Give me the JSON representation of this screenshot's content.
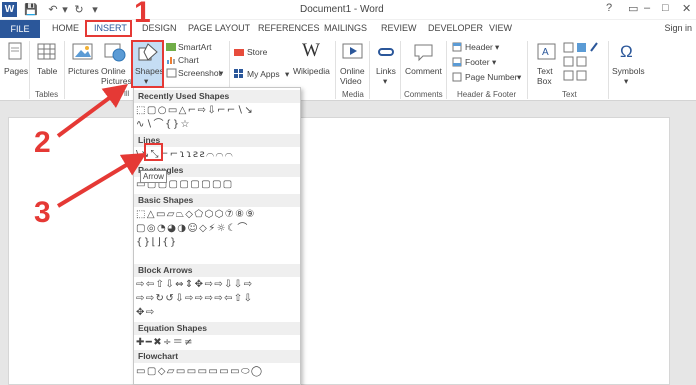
{
  "window": {
    "title": "Document1 - Word",
    "help": "?",
    "minimize": "–",
    "restore": "□",
    "close": "✕"
  },
  "tabs": {
    "file": "FILE",
    "items": [
      "HOME",
      "INSERT",
      "DESIGN",
      "PAGE LAYOUT",
      "REFERENCES",
      "MAILINGS",
      "REVIEW",
      "DEVELOPER",
      "VIEW"
    ],
    "sign_in": "Sign in"
  },
  "ribbon": {
    "pages": "Pages",
    "table": "Table",
    "pictures": "Pictures",
    "online_pictures": "Online Pictures",
    "shapes": "Shapes",
    "smartart": "SmartArt",
    "chart": "Chart",
    "screenshot": "Screenshot",
    "store": "Store",
    "my_apps": "My Apps",
    "wikipedia": "Wikipedia",
    "online_video": "Online Video",
    "links": "Links",
    "comment": "Comment",
    "header": "Header",
    "footer": "Footer",
    "page_number": "Page Number",
    "text_box": "Text Box",
    "symbols": "Symbols",
    "groups": {
      "tables": "Tables",
      "media": "Media",
      "comments": "Comments",
      "header_footer": "Header & Footer",
      "text": "Text"
    },
    "word_logo_glyph": "W",
    "wikipedia_glyph": "W",
    "omega_glyph": "Ω"
  },
  "shapes_gallery": {
    "categories": [
      {
        "name": "Recently Used Shapes",
        "rows": [
          "⬚▢○▭△⌐⇨⇩⌐⌐∖↘",
          "∿∖⌒{}☆"
        ]
      },
      {
        "name": "Lines",
        "rows": [
          "\\↘⤡⌐⌐ɿɿƨƨ⌒⌒⌒"
        ]
      },
      {
        "name": "Rectangles",
        "rows": [
          "▭▢▢▢▢▢▢▢▢"
        ]
      },
      {
        "name": "Basic Shapes",
        "rows": [
          "⬚△▭▱⏢◇⬠⬡⬡⑦⑧⑨",
          "▢◎◔◕◑☺◇⚡☼☾⌒",
          "{}⌊⌋{}"
        ]
      },
      {
        "name": "Block Arrows",
        "rows": [
          "⇨⇦⇧⇩⇔⇕✥⇨⇨⇩⇩⇨",
          "⇨⇨↻↺⇩⇨⇨⇨⇨⇦⇧⇩",
          "✥⇨"
        ]
      },
      {
        "name": "Equation Shapes",
        "rows": [
          "✚━✖÷＝≠"
        ]
      },
      {
        "name": "Flowchart",
        "rows": [
          "▭▢◇▱▭▭▭▭▭▭⬭◯"
        ]
      }
    ],
    "tooltip": "Arrow"
  },
  "annotations": {
    "step1": "1",
    "step2": "2",
    "step3": "3",
    "color": "#e53935"
  }
}
